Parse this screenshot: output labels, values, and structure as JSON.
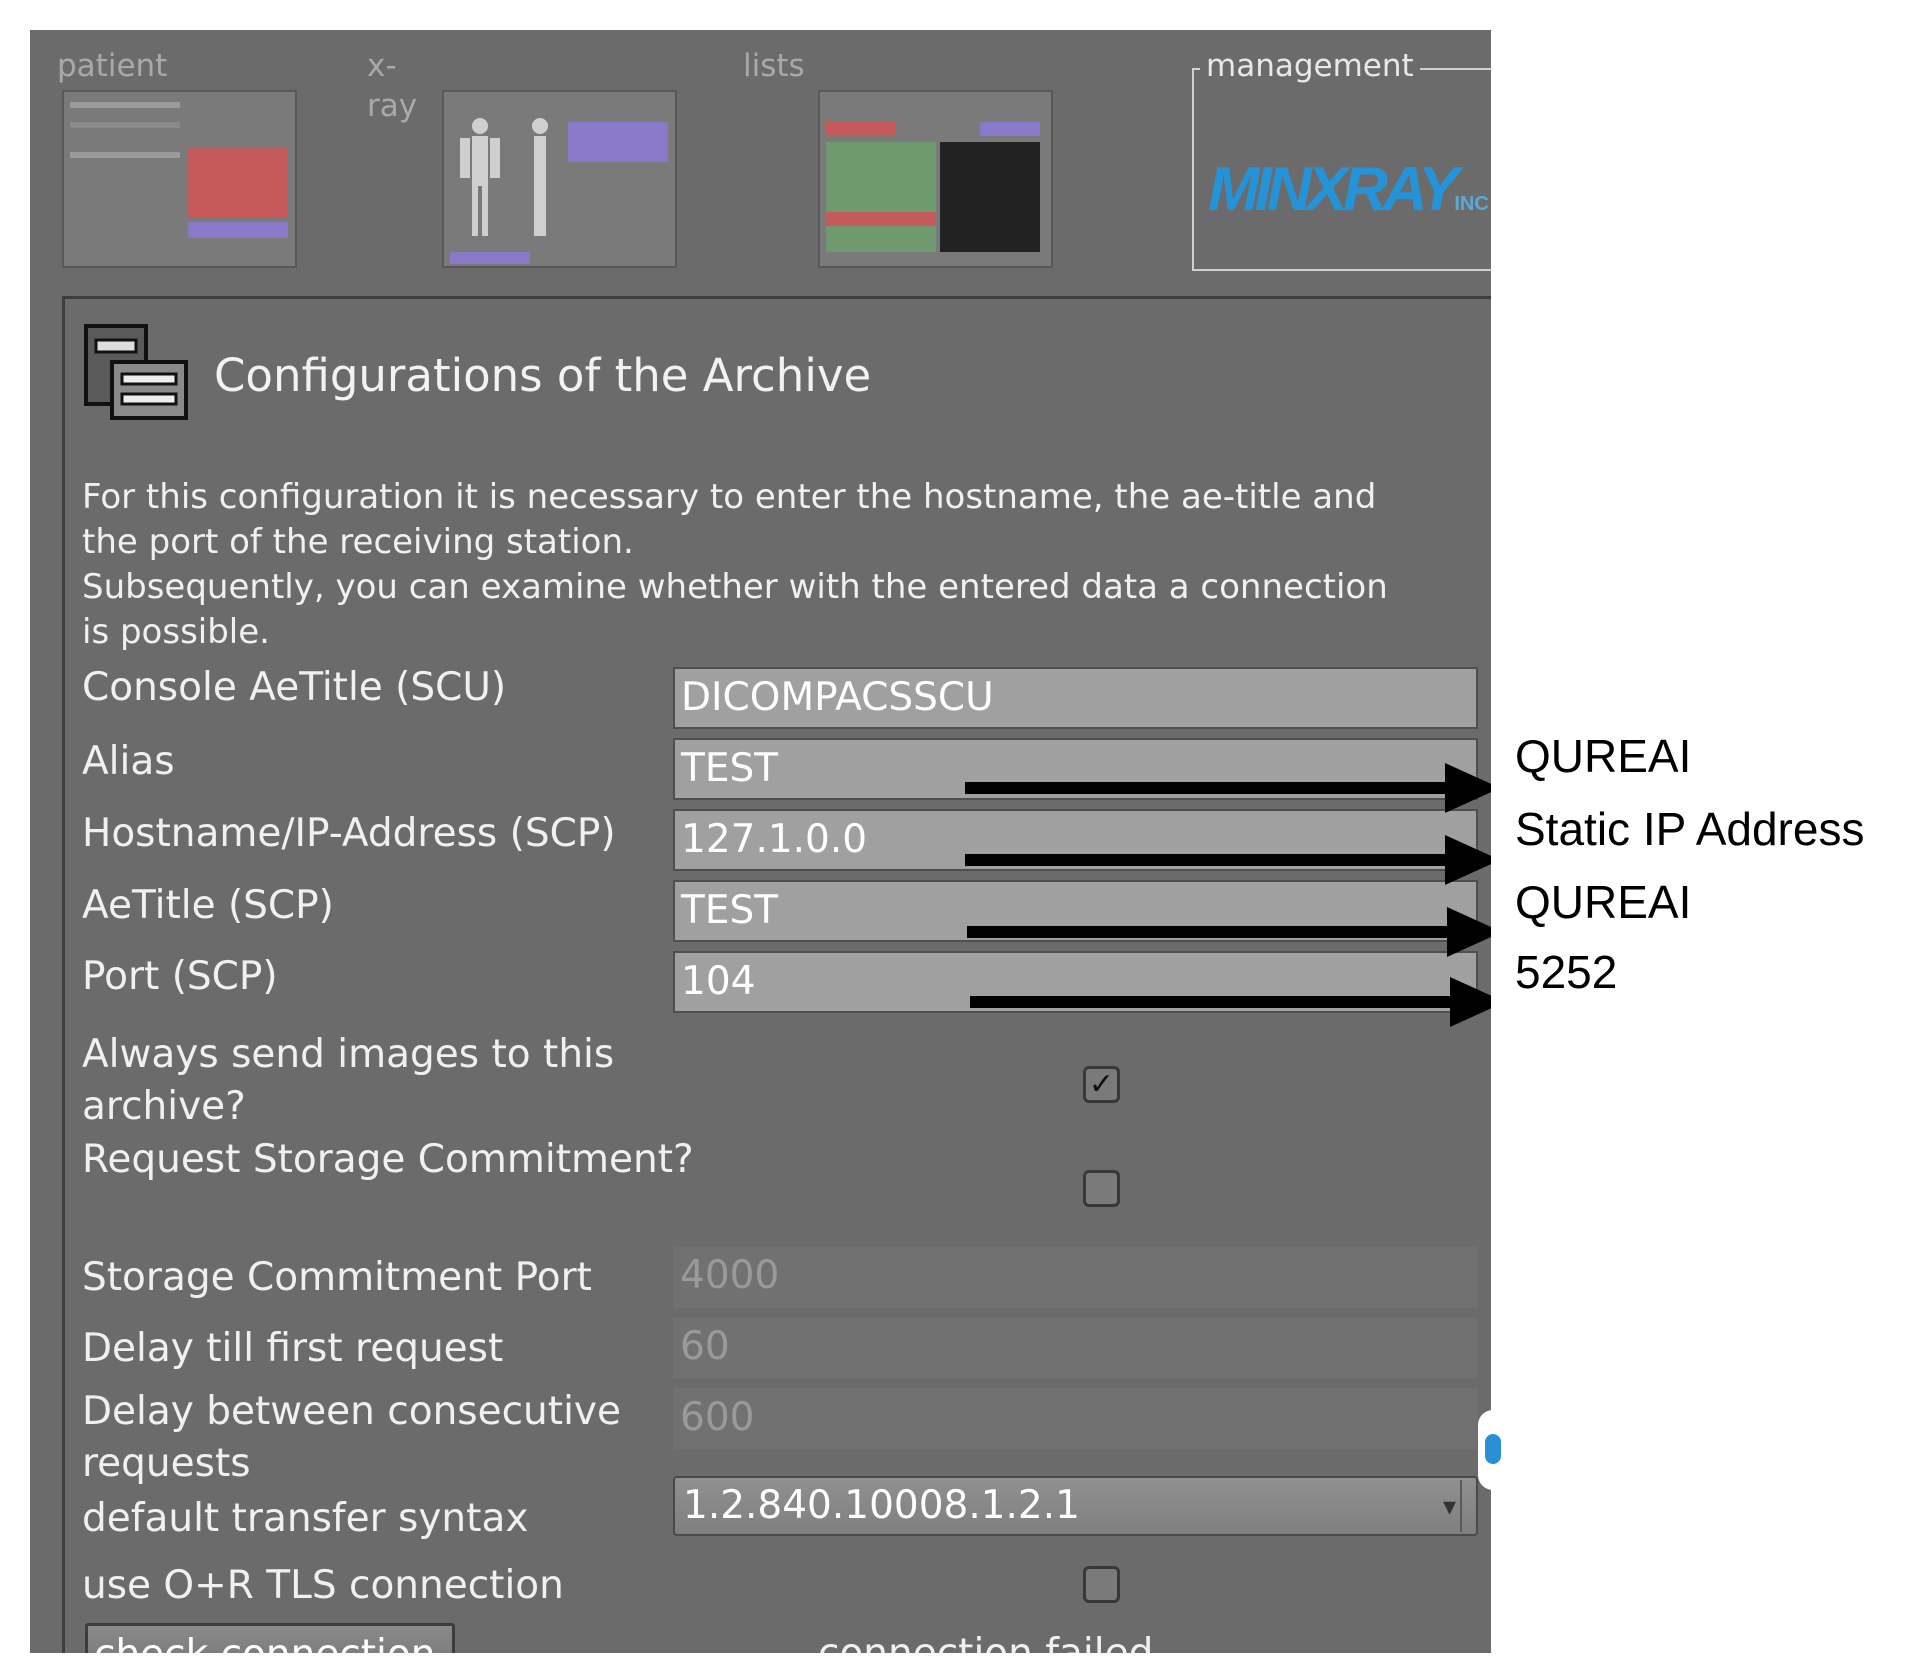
{
  "tabs": [
    {
      "label": "patient"
    },
    {
      "label": "x-ray"
    },
    {
      "label": "lists"
    },
    {
      "label": "management"
    }
  ],
  "logo": {
    "text": "MINXRAY",
    "suffix": "INC",
    "color": "#2493d8"
  },
  "panel": {
    "title": "Configurations of the Archive",
    "description": [
      "For this configuration it is necessary to enter the hostname, the ae-title and",
      "the port of the receiving station.",
      "Subsequently, you can examine whether with the entered data a connection",
      "is possible."
    ]
  },
  "fields": {
    "console_aetitle": {
      "label": "Console AeTitle (SCU)",
      "value": "DICOMPACSSCU"
    },
    "alias": {
      "label": "Alias",
      "value": "TEST"
    },
    "hostname": {
      "label": "Hostname/IP-Address (SCP)",
      "value": "127.1.0.0"
    },
    "aetitle": {
      "label": "AeTitle (SCP)",
      "value": "TEST"
    },
    "port": {
      "label": "Port (SCP)",
      "value": "104"
    },
    "always_send": {
      "label": "Always send images to this archive?",
      "checked": true
    },
    "storage_commitment": {
      "label": "Request Storage Commitment?",
      "checked": false
    },
    "storage_commitment_port": {
      "label": "Storage Commitment Port",
      "value": "4000"
    },
    "delay_first": {
      "label": "Delay till first request",
      "value": "60"
    },
    "delay_between": {
      "label": "Delay between consecutive requests",
      "value": "600"
    },
    "transfer_syntax": {
      "label": "default transfer syntax",
      "value": "1.2.840.10008.1.2.1"
    },
    "tls": {
      "label": "use O+R TLS connection",
      "checked": false
    }
  },
  "actions": {
    "check_connection": "check connection",
    "status": "connection failed"
  },
  "annotations": {
    "alias": "QUREAI",
    "hostname": "Static IP Address",
    "aetitle": "QUREAI",
    "port": "5252"
  },
  "icons": {
    "archive": "archive-icon",
    "checkmark": "✓",
    "select_caret": "▾"
  },
  "colors": {
    "background": "#6b6b6b",
    "input_bg": "#a0a0a0",
    "annotation_text": "#000000"
  }
}
